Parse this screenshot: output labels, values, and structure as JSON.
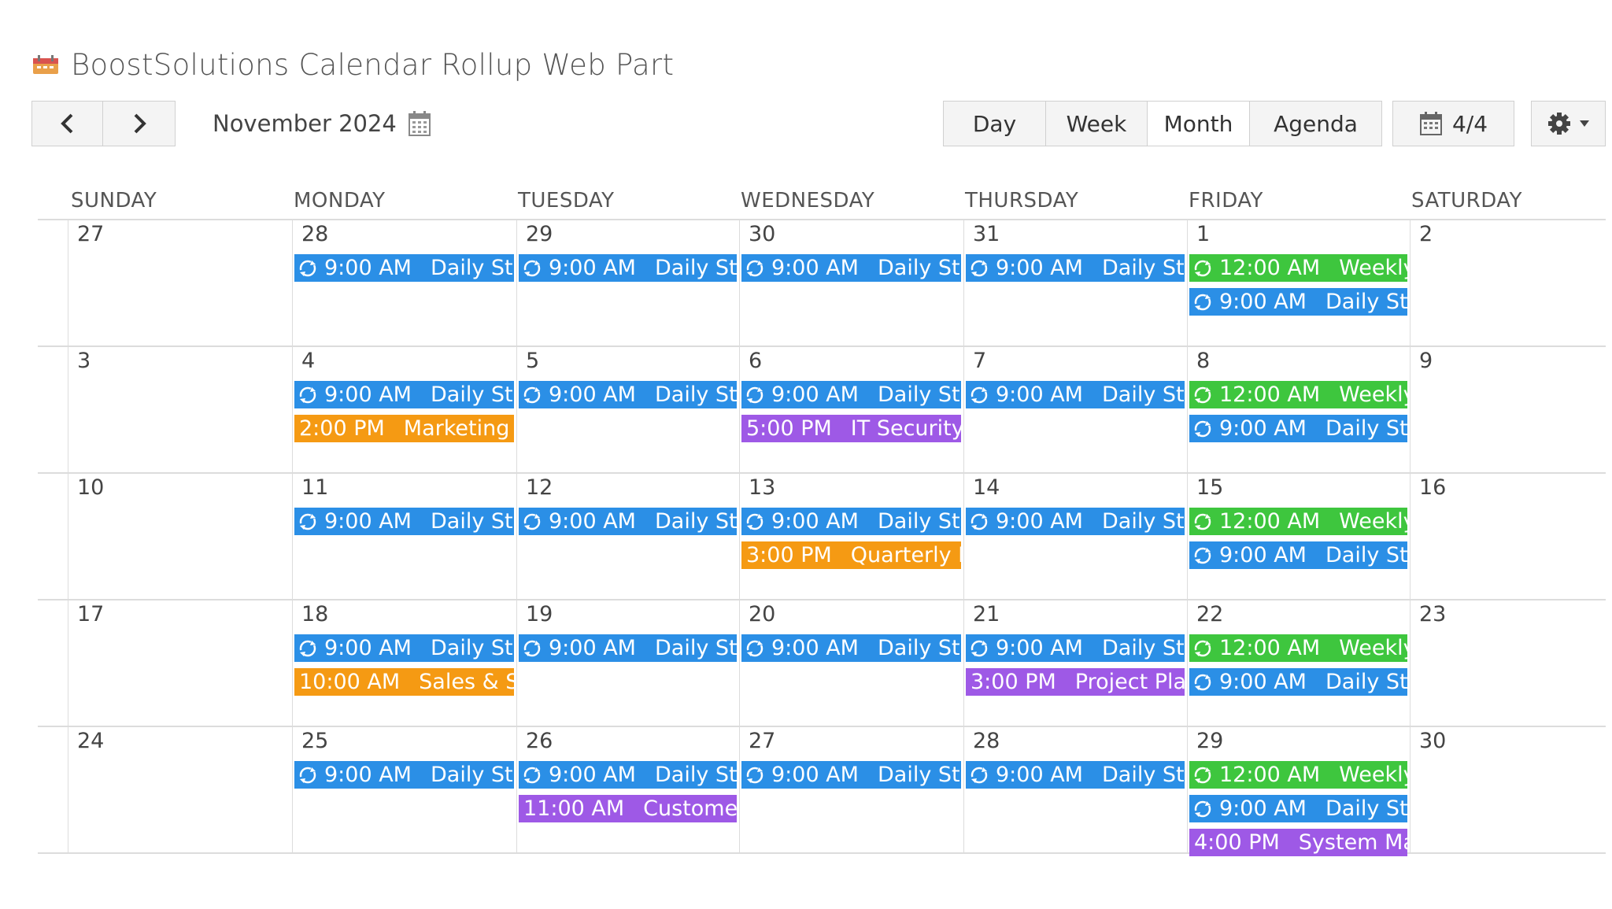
{
  "app": {
    "title": "BoostSolutions Calendar Rollup Web Part"
  },
  "toolbar": {
    "month_label": "November 2024",
    "views": [
      "Day",
      "Week",
      "Month",
      "Agenda"
    ],
    "active_view": "Month",
    "calendar_count": "4/4"
  },
  "weekdays": [
    "SUNDAY",
    "MONDAY",
    "TUESDAY",
    "WEDNESDAY",
    "THURSDAY",
    "FRIDAY",
    "SATURDAY"
  ],
  "colors": {
    "blue": "#2b8fe6",
    "green": "#3ec63e",
    "orange": "#f59a13",
    "purple": "#9e59e6"
  },
  "weeks": [
    {
      "days": [
        {
          "num": "27",
          "events": []
        },
        {
          "num": "28",
          "events": [
            {
              "time": "9:00 AM",
              "title": "Daily Stand-up",
              "color": "blue",
              "recurring": true
            }
          ]
        },
        {
          "num": "29",
          "events": [
            {
              "time": "9:00 AM",
              "title": "Daily Stand-up",
              "color": "blue",
              "recurring": true
            }
          ]
        },
        {
          "num": "30",
          "events": [
            {
              "time": "9:00 AM",
              "title": "Daily Stand-up",
              "color": "blue",
              "recurring": true
            }
          ]
        },
        {
          "num": "31",
          "events": [
            {
              "time": "9:00 AM",
              "title": "Daily Stand-up",
              "color": "blue",
              "recurring": true
            }
          ]
        },
        {
          "num": "1",
          "events": [
            {
              "time": "12:00 AM",
              "title": "Weekly",
              "color": "green",
              "recurring": true
            },
            {
              "time": "9:00 AM",
              "title": "Daily Stand-up",
              "color": "blue",
              "recurring": true
            }
          ]
        },
        {
          "num": "2",
          "events": []
        }
      ]
    },
    {
      "days": [
        {
          "num": "3",
          "events": []
        },
        {
          "num": "4",
          "events": [
            {
              "time": "9:00 AM",
              "title": "Daily Stand-up",
              "color": "blue",
              "recurring": true
            },
            {
              "time": "2:00 PM",
              "title": "Marketing &",
              "color": "orange",
              "recurring": false
            }
          ]
        },
        {
          "num": "5",
          "events": [
            {
              "time": "9:00 AM",
              "title": "Daily Stand-up",
              "color": "blue",
              "recurring": true
            }
          ]
        },
        {
          "num": "6",
          "events": [
            {
              "time": "9:00 AM",
              "title": "Daily Stand-up",
              "color": "blue",
              "recurring": true
            },
            {
              "time": "5:00 PM",
              "title": "IT Security B",
              "color": "purple",
              "recurring": false
            }
          ]
        },
        {
          "num": "7",
          "events": [
            {
              "time": "9:00 AM",
              "title": "Daily Stand-up",
              "color": "blue",
              "recurring": true
            }
          ]
        },
        {
          "num": "8",
          "events": [
            {
              "time": "12:00 AM",
              "title": "Weekly",
              "color": "green",
              "recurring": true
            },
            {
              "time": "9:00 AM",
              "title": "Daily Stand-up",
              "color": "blue",
              "recurring": true
            }
          ]
        },
        {
          "num": "9",
          "events": []
        }
      ]
    },
    {
      "days": [
        {
          "num": "10",
          "events": []
        },
        {
          "num": "11",
          "events": [
            {
              "time": "9:00 AM",
              "title": "Daily Stand-up",
              "color": "blue",
              "recurring": true
            }
          ]
        },
        {
          "num": "12",
          "events": [
            {
              "time": "9:00 AM",
              "title": "Daily Stand-up",
              "color": "blue",
              "recurring": true
            }
          ]
        },
        {
          "num": "13",
          "events": [
            {
              "time": "9:00 AM",
              "title": "Daily Stand-up",
              "color": "blue",
              "recurring": true
            },
            {
              "time": "3:00 PM",
              "title": "Quarterly Bu",
              "color": "orange",
              "recurring": false
            }
          ]
        },
        {
          "num": "14",
          "events": [
            {
              "time": "9:00 AM",
              "title": "Daily Stand-up",
              "color": "blue",
              "recurring": true
            }
          ]
        },
        {
          "num": "15",
          "events": [
            {
              "time": "12:00 AM",
              "title": "Weekly",
              "color": "green",
              "recurring": true
            },
            {
              "time": "9:00 AM",
              "title": "Daily Stand-up",
              "color": "blue",
              "recurring": true
            }
          ]
        },
        {
          "num": "16",
          "events": []
        }
      ]
    },
    {
      "days": [
        {
          "num": "17",
          "events": []
        },
        {
          "num": "18",
          "events": [
            {
              "time": "9:00 AM",
              "title": "Daily Stand-up",
              "color": "blue",
              "recurring": true
            },
            {
              "time": "10:00 AM",
              "title": "Sales & Str",
              "color": "orange",
              "recurring": false
            }
          ]
        },
        {
          "num": "19",
          "events": [
            {
              "time": "9:00 AM",
              "title": "Daily Stand-up",
              "color": "blue",
              "recurring": true
            }
          ]
        },
        {
          "num": "20",
          "events": [
            {
              "time": "9:00 AM",
              "title": "Daily Stand-up",
              "color": "blue",
              "recurring": true
            }
          ]
        },
        {
          "num": "21",
          "events": [
            {
              "time": "9:00 AM",
              "title": "Daily Stand-up",
              "color": "blue",
              "recurring": true
            },
            {
              "time": "3:00 PM",
              "title": "Project Plan",
              "color": "purple",
              "recurring": false
            }
          ]
        },
        {
          "num": "22",
          "events": [
            {
              "time": "12:00 AM",
              "title": "Weekly",
              "color": "green",
              "recurring": true
            },
            {
              "time": "9:00 AM",
              "title": "Daily Stand-up",
              "color": "blue",
              "recurring": true
            }
          ]
        },
        {
          "num": "23",
          "events": []
        }
      ]
    },
    {
      "days": [
        {
          "num": "24",
          "events": []
        },
        {
          "num": "25",
          "events": [
            {
              "time": "9:00 AM",
              "title": "Daily Stand-up",
              "color": "blue",
              "recurring": true
            }
          ]
        },
        {
          "num": "26",
          "events": [
            {
              "time": "9:00 AM",
              "title": "Daily Stand-up",
              "color": "blue",
              "recurring": true
            },
            {
              "time": "11:00 AM",
              "title": "Customer",
              "color": "purple",
              "recurring": false
            }
          ]
        },
        {
          "num": "27",
          "events": [
            {
              "time": "9:00 AM",
              "title": "Daily Stand-up",
              "color": "blue",
              "recurring": true
            }
          ]
        },
        {
          "num": "28",
          "events": [
            {
              "time": "9:00 AM",
              "title": "Daily Stand-up",
              "color": "blue",
              "recurring": true
            }
          ]
        },
        {
          "num": "29",
          "events": [
            {
              "time": "12:00 AM",
              "title": "Weekly",
              "color": "green",
              "recurring": true
            },
            {
              "time": "9:00 AM",
              "title": "Daily Stand-up",
              "color": "blue",
              "recurring": true
            },
            {
              "time": "4:00 PM",
              "title": "System Main",
              "color": "purple",
              "recurring": false
            }
          ]
        },
        {
          "num": "30",
          "events": []
        }
      ]
    }
  ]
}
